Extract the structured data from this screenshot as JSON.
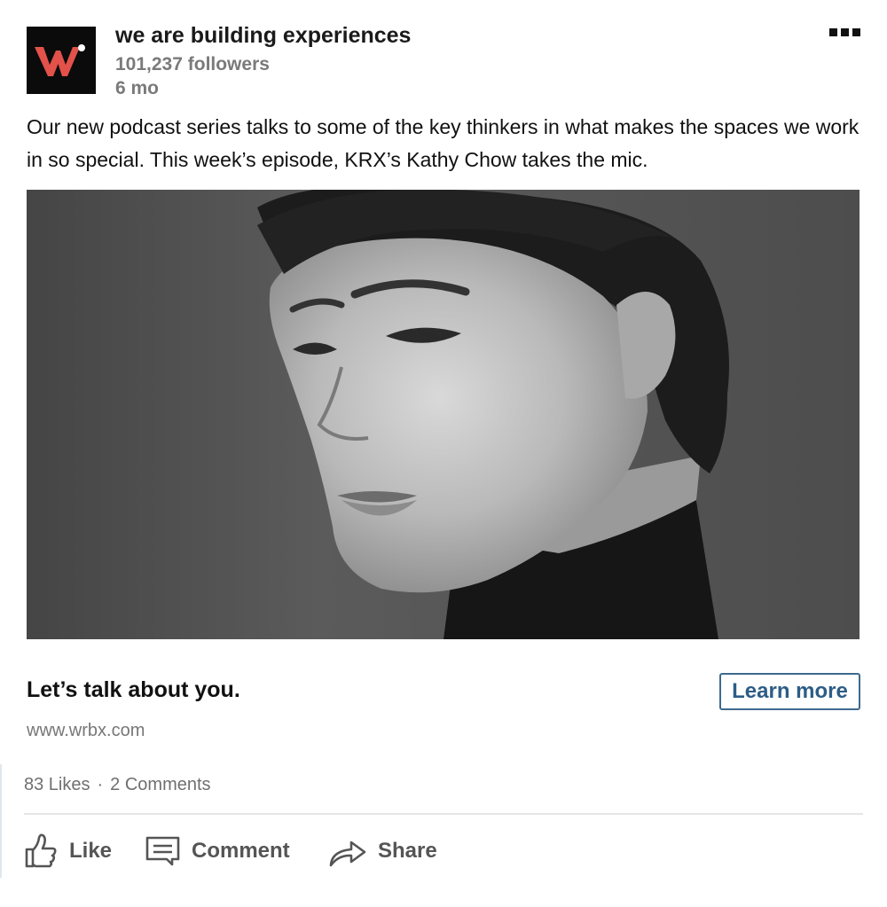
{
  "company": {
    "name": "we are building experiences",
    "followers": "101,237 followers",
    "age": "6 mo",
    "logo_letter": "W",
    "logo_colors": {
      "background": "#0b0b0b",
      "letter": "#e2524a",
      "dot": "#ffffff"
    }
  },
  "post": {
    "text": "Our new podcast series talks to some of the key thinkers in what makes the spaces we work in so special. This week’s episode, KRX’s Kathy Chow takes the mic."
  },
  "cta": {
    "headline": "Let’s talk about you.",
    "button_label": "Learn more",
    "domain": "www.wrbx.com"
  },
  "social": {
    "likes": "83 Likes",
    "separator": "·",
    "comments": "2 Comments"
  },
  "actions": [
    {
      "label": "Like",
      "icon": "thumbs-up-icon"
    },
    {
      "label": "Comment",
      "icon": "comment-icon"
    },
    {
      "label": "Share",
      "icon": "share-arrow-icon"
    }
  ],
  "colors": {
    "accent_button": "#2d5d86",
    "muted_text": "#7a7a7a",
    "action_text": "#555555"
  }
}
